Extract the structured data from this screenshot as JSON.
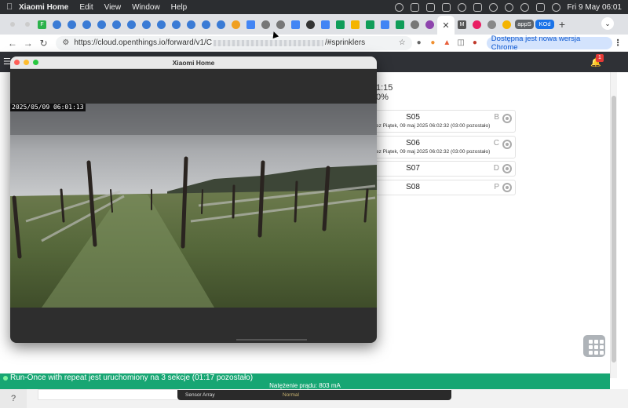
{
  "menubar": {
    "app_name": "Xiaomi Home",
    "menus": [
      "Edit",
      "View",
      "Window",
      "Help"
    ],
    "clock": "Fri 9 May  06:01"
  },
  "tabstrip": {
    "favicons": [
      {
        "name": "feedly-icon",
        "color": "#2bb24c",
        "label": "F"
      },
      {
        "name": "site-icon",
        "color": "#3a7bd5"
      },
      {
        "name": "site-icon",
        "color": "#3a7bd5"
      },
      {
        "name": "site-icon",
        "color": "#3a7bd5"
      },
      {
        "name": "site-icon",
        "color": "#3a7bd5"
      },
      {
        "name": "site-icon",
        "color": "#3a7bd5"
      },
      {
        "name": "site-icon",
        "color": "#3a7bd5"
      },
      {
        "name": "site-icon",
        "color": "#3a7bd5"
      },
      {
        "name": "site-icon",
        "color": "#3a7bd5"
      },
      {
        "name": "site-icon",
        "color": "#3a7bd5"
      },
      {
        "name": "site-icon",
        "color": "#3a7bd5"
      },
      {
        "name": "site-icon",
        "color": "#3a7bd5"
      },
      {
        "name": "site-icon",
        "color": "#3a7bd5"
      },
      {
        "name": "site-icon",
        "color": "#f0a020"
      },
      {
        "name": "docs-icon",
        "color": "#4285f4"
      },
      {
        "name": "site-icon",
        "color": "#777777"
      },
      {
        "name": "site-icon",
        "color": "#777777"
      },
      {
        "name": "docs-icon",
        "color": "#4285f4"
      },
      {
        "name": "site-icon",
        "color": "#333333"
      },
      {
        "name": "docs-icon",
        "color": "#4285f4"
      },
      {
        "name": "sheets-icon",
        "color": "#0f9d58"
      },
      {
        "name": "drive-icon",
        "color": "#f4b400"
      },
      {
        "name": "sheets-icon",
        "color": "#0f9d58"
      },
      {
        "name": "docs-icon",
        "color": "#4285f4"
      },
      {
        "name": "sheets-icon",
        "color": "#0f9d58"
      },
      {
        "name": "site-icon",
        "color": "#777777"
      },
      {
        "name": "site-icon",
        "color": "#8e44ad"
      }
    ],
    "active_tab_close": "✕",
    "favicons_after": [
      {
        "name": "site-icon",
        "color": "#555555",
        "label": "M"
      },
      {
        "name": "site-icon",
        "color": "#e91e63"
      },
      {
        "name": "site-icon",
        "color": "#888888"
      },
      {
        "name": "site-icon",
        "color": "#f4b400"
      }
    ],
    "group_1": "appS",
    "group_2": "KOd",
    "new_tab": "+",
    "tab_search": "⌄"
  },
  "toolbar": {
    "url_prefix": "https://cloud.openthings.io/forward/v1/C",
    "url_suffix": "/#sprinklers",
    "update_label": "Dostępna jest nowa wersja Chrome"
  },
  "page": {
    "notification_count": "1",
    "stat_line_1": "1:15",
    "stat_line_2": "0%",
    "stations": [
      {
        "name": "S05",
        "sub": "ez Piątek, 09 maj 2025 06:02:32 (03:00 pozostało)",
        "letter": "B"
      },
      {
        "name": "S06",
        "sub": "ez Piątek, 09 maj 2025 06:02:32 (03:00 pozostało)",
        "letter": "C"
      },
      {
        "name": "S07",
        "sub": "",
        "letter": "D"
      },
      {
        "name": "S08",
        "sub": "",
        "letter": "P"
      }
    ],
    "status_message": "Run-Once with repeat jest uruchomiony na 3 sekcje (01:17 pozostało)",
    "current_label": "Natężenie prądu: 803 mA",
    "help_label": "?"
  },
  "sensorbar": {
    "label": "Sensor Array",
    "value": "Normal"
  },
  "xiaomi_window": {
    "title": "Xiaomi Home",
    "timestamp": "2025/05/09  06:01:13"
  }
}
